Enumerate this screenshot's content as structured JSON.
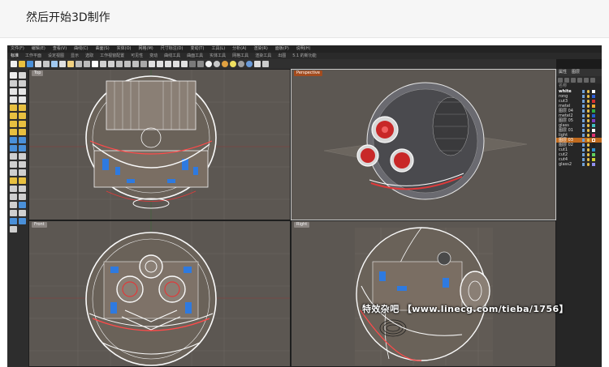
{
  "post": {
    "title": "然后开始3D制作"
  },
  "app": {
    "menu": [
      "文件(F)",
      "编辑(E)",
      "查看(V)",
      "曲线(C)",
      "曲面(S)",
      "实体(O)",
      "网格(M)",
      "尺寸标注(D)",
      "变动(T)",
      "工具(L)",
      "分析(A)",
      "渲染(R)",
      "面板(P)",
      "说明(H)"
    ],
    "tabs": [
      "标准",
      "工作平面",
      "设定视图",
      "显示",
      "选取",
      "工作视窗配置",
      "可见性",
      "变动",
      "曲线工具",
      "曲面工具",
      "实体工具",
      "网格工具",
      "渲染工具",
      "出图",
      "5.1 的新功能"
    ],
    "active_tab": 0
  },
  "viewports": {
    "top": "Top",
    "perspective": "Perspective",
    "front": "Front",
    "right": "Right"
  },
  "panel": {
    "tabs": [
      "属性",
      "图层"
    ],
    "header": "名称",
    "layers": [
      {
        "name": "white",
        "color": "#ffffff",
        "bold": true
      },
      {
        "name": "rong",
        "color": "#3060d8"
      },
      {
        "name": "cut3",
        "color": "#d83030"
      },
      {
        "name": "metel",
        "color": "#f0a830"
      },
      {
        "name": "图层 04",
        "color": "#30b040"
      },
      {
        "name": "metel2",
        "color": "#2060d0"
      },
      {
        "name": "图层 05",
        "color": "#8040c0"
      },
      {
        "name": "glass",
        "color": "#40c0c0"
      },
      {
        "name": "图层 01",
        "color": "#ffffff"
      },
      {
        "name": "light",
        "color": "#e03070"
      },
      {
        "name": "图层 03",
        "color": "#c06a1e",
        "selected": true
      },
      {
        "name": "图层 02",
        "color": "#202020"
      },
      {
        "name": "cut1",
        "color": "#3090d0"
      },
      {
        "name": "cut2",
        "color": "#60d060"
      },
      {
        "name": "cut4",
        "color": "#d0d030"
      },
      {
        "name": "glass2",
        "color": "#9090f0"
      }
    ]
  },
  "watermark": "特效杂吧 【www.linecg.com/tieba/1756】",
  "colors": {
    "viewport_bg": "#5c5752",
    "active_layer": "#c06a1e",
    "wire": "#f5f5f5",
    "accent_red": "#e03a3a",
    "accent_blue": "#2e7ae0"
  }
}
